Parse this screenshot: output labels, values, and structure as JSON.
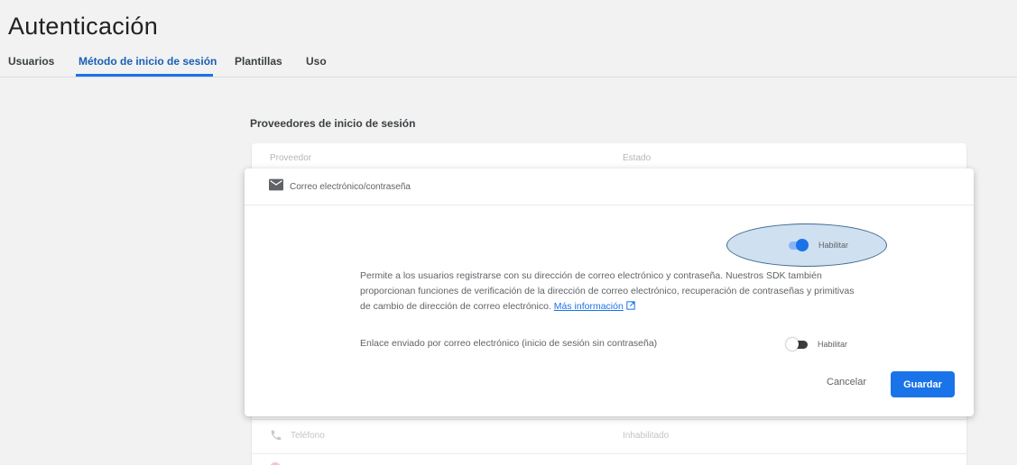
{
  "page": {
    "title": "Autenticación"
  },
  "tabs": [
    {
      "label": "Usuarios",
      "active": false
    },
    {
      "label": "Método de inicio de sesión",
      "active": true
    },
    {
      "label": "Plantillas",
      "active": false
    },
    {
      "label": "Uso",
      "active": false
    }
  ],
  "providers": {
    "heading": "Proveedores de inicio de sesión",
    "columns": {
      "provider": "Proveedor",
      "status": "Estado"
    },
    "expanded": {
      "name": "Correo electrónico/contraseña",
      "icon": "mail-icon",
      "enable_toggle": {
        "label": "Habilitar",
        "on": true
      },
      "description": "Permite a los usuarios registrarse con su dirección de correo electrónico y contraseña. Nuestros SDK también proporcionan funciones de verificación de la dirección de correo electrónico, recuperación de contraseñas y primitivas de cambio de dirección de correo electrónico.",
      "more_info_link": "Más información",
      "email_link": {
        "label": "Enlace enviado por correo electrónico (inicio de sesión sin contraseña)",
        "toggle_label": "Habilitar",
        "on": false
      },
      "cancel_label": "Cancelar",
      "save_label": "Guardar"
    },
    "rows": [
      {
        "name": "Teléfono",
        "status": "Inhabilitado",
        "icon": "phone-icon"
      }
    ]
  },
  "colors": {
    "accent": "#1a73e8",
    "highlight": "#cfe0f0",
    "highlight_border": "#3f6a8f"
  }
}
